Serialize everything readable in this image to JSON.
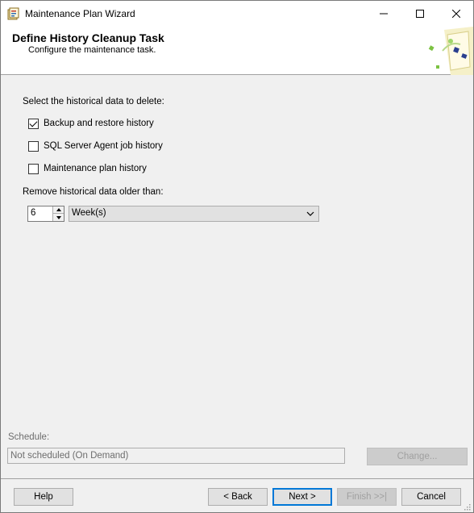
{
  "window": {
    "title": "Maintenance Plan Wizard",
    "controls": [
      "minimize-icon",
      "maximize-icon",
      "close-icon"
    ]
  },
  "header": {
    "title": "Define History Cleanup Task",
    "subtitle": "Configure the maintenance task."
  },
  "content": {
    "select_label": "Select the historical data to delete:",
    "options": [
      {
        "label": "Backup and restore history",
        "checked": true
      },
      {
        "label": "SQL Server Agent job history",
        "checked": false
      },
      {
        "label": "Maintenance plan history",
        "checked": false
      }
    ],
    "remove_label": "Remove historical data older than:",
    "age_value": "6",
    "age_unit": "Week(s)"
  },
  "schedule": {
    "label": "Schedule:",
    "value": "Not scheduled (On Demand)",
    "change_label": "Change..."
  },
  "footer": {
    "help_label": "Help",
    "back_label": "< Back",
    "next_label": "Next >",
    "finish_label": "Finish >>|",
    "cancel_label": "Cancel"
  },
  "colors": {
    "focus_border": "#0078d7",
    "background": "#f0f0f0"
  }
}
